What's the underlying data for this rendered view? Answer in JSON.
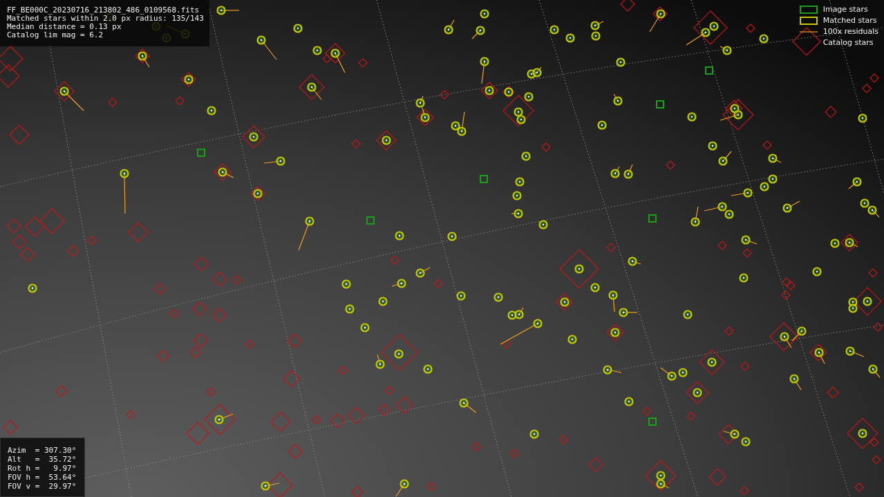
{
  "info": {
    "lines": [
      "FF_BE000C_20230716_213802_486_0109568.fits",
      "Matched stars within 2.0 px radius: 135/143",
      "Median distance = 0.13 px",
      "Catalog lim mag = 6.2"
    ]
  },
  "legend": [
    {
      "kind": "image",
      "label": "Image stars"
    },
    {
      "kind": "matched",
      "label": "Matched stars"
    },
    {
      "kind": "residual",
      "label": "100x residuals"
    },
    {
      "kind": "catalog",
      "label": "Catalog stars"
    }
  ],
  "pointing": [
    "Azim  = 307.30°",
    "Alt   =  35.72°",
    "Rot h =   9.97°",
    "FOV h =  53.64°",
    "FOV v =  29.97°"
  ]
}
